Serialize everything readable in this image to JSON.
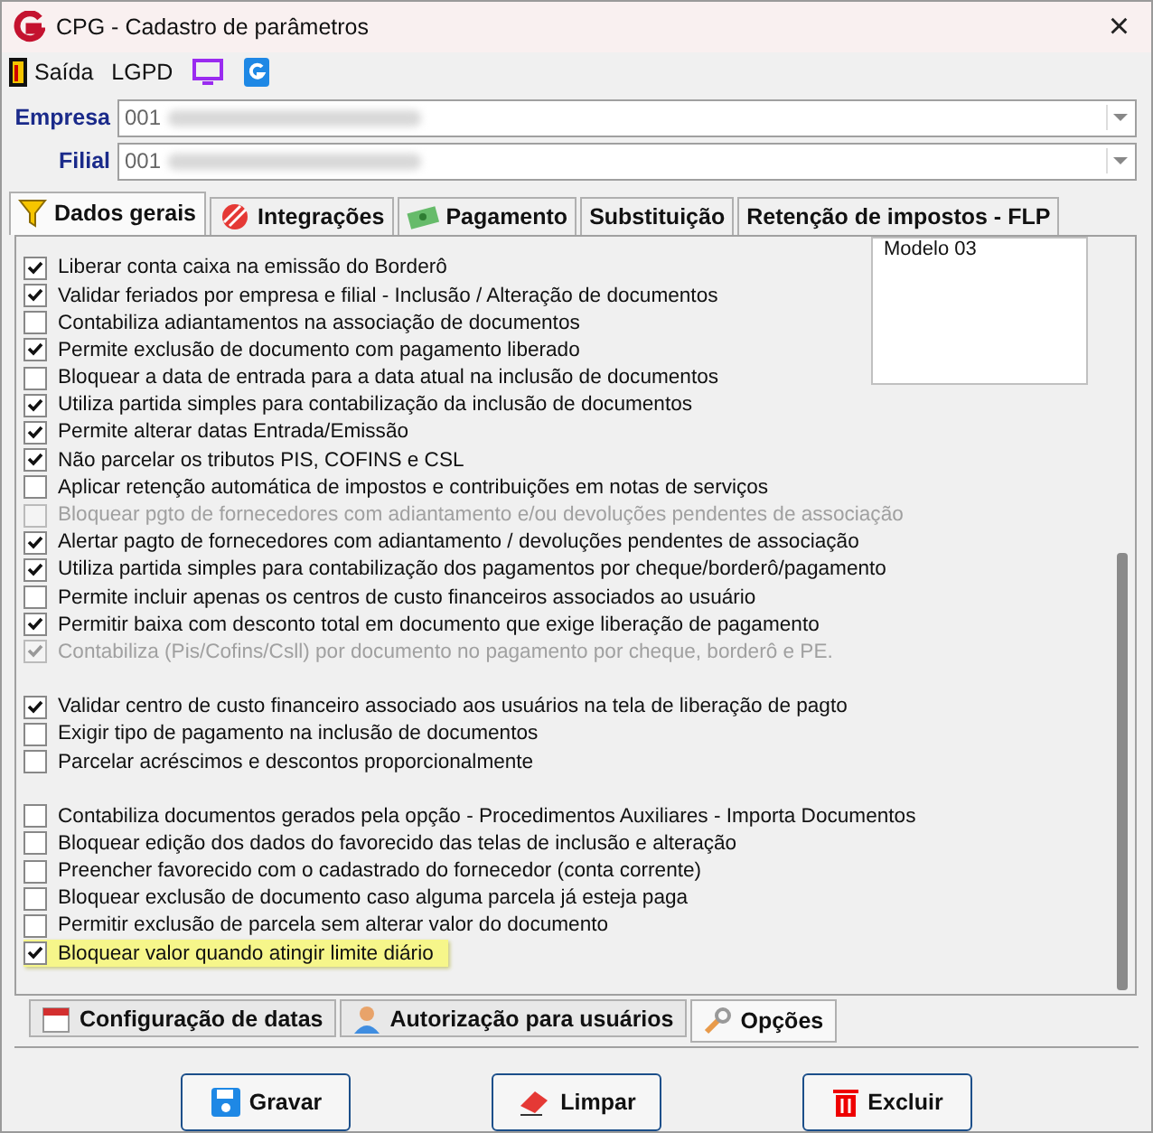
{
  "window": {
    "title": "CPG - Cadastro de parâmetros",
    "close": "×"
  },
  "toolbar": [
    {
      "kind": "exit",
      "label": "Saída"
    },
    {
      "kind": "text",
      "label": "LGPD"
    },
    {
      "kind": "monitor"
    },
    {
      "kind": "logo"
    }
  ],
  "fields": [
    {
      "label": "Empresa",
      "value": "001",
      "redacted": true
    },
    {
      "label": "Filial",
      "value": "001",
      "redacted": true
    }
  ],
  "tabs": [
    {
      "label": "Dados gerais",
      "selected": true
    },
    {
      "label": "Integrações",
      "selected": false
    },
    {
      "label": "Pagamento",
      "selected": false
    },
    {
      "label": "Substituição",
      "selected": false
    },
    {
      "label": "Retenção de impostos - FLP",
      "selected": false
    }
  ],
  "side_list": [
    "Modelo 03"
  ],
  "option_groups": [
    {
      "options": [
        {
          "label": "Liberar conta caixa na emissão do Borderô",
          "checked": true,
          "disabled": false
        },
        {
          "label": "Validar feriados por empresa e filial - Inclusão / Alteração de documentos",
          "checked": true,
          "disabled": false
        },
        {
          "label": "Contabiliza adiantamentos na associação de documentos",
          "checked": false,
          "disabled": false
        },
        {
          "label": "Permite exclusão de documento com pagamento liberado",
          "checked": true,
          "disabled": false
        },
        {
          "label": "Bloquear a data de entrada para a data atual na inclusão de documentos",
          "checked": false,
          "disabled": false
        },
        {
          "label": "Utiliza partida simples para contabilização da inclusão de documentos",
          "checked": true,
          "disabled": false
        },
        {
          "label": "Permite alterar datas Entrada/Emissão",
          "checked": true,
          "disabled": false
        },
        {
          "label": "Não parcelar os tributos PIS, COFINS e CSL",
          "checked": true,
          "disabled": false
        },
        {
          "label": "Aplicar retenção automática de impostos e contribuições em notas de serviços",
          "checked": false,
          "disabled": false
        },
        {
          "label": "Bloquear pgto de fornecedores com adiantamento e/ou devoluções pendentes de associação",
          "checked": false,
          "disabled": true
        },
        {
          "label": "Alertar pagto de fornecedores com adiantamento / devoluções pendentes de associação",
          "checked": true,
          "disabled": false
        },
        {
          "label": "Utiliza partida simples para contabilização dos pagamentos por cheque/borderô/pagamento",
          "checked": true,
          "disabled": false
        },
        {
          "label": "Permite incluir apenas os centros de custo financeiros associados ao usuário",
          "checked": false,
          "disabled": false
        },
        {
          "label": "Permitir baixa com desconto total em documento que exige liberação de pagamento",
          "checked": true,
          "disabled": false
        },
        {
          "label": "Contabiliza (Pis/Cofins/Csll) por documento no pagamento por cheque, borderô e PE.",
          "checked": true,
          "disabled": true
        }
      ]
    },
    {
      "options": [
        {
          "label": "Validar centro de custo financeiro associado aos usuários na tela de liberação de pagto",
          "checked": true,
          "disabled": false
        },
        {
          "label": "Exigir tipo de pagamento na inclusão de documentos",
          "checked": false,
          "disabled": false
        },
        {
          "label": "Parcelar acréscimos e descontos proporcionalmente",
          "checked": false,
          "disabled": false
        }
      ]
    },
    {
      "options": [
        {
          "label": "Contabiliza documentos gerados pela opção - Procedimentos Auxiliares - Importa Documentos",
          "checked": false,
          "disabled": false
        },
        {
          "label": "Bloquear edição dos dados do  favorecido das telas de inclusão e alteração",
          "checked": false,
          "disabled": false
        },
        {
          "label": "Preencher favorecido com o cadastrado do fornecedor (conta corrente)",
          "checked": false,
          "disabled": false
        },
        {
          "label": "Bloquear exclusão de documento caso alguma parcela já esteja paga",
          "checked": false,
          "disabled": false
        },
        {
          "label": "Permitir exclusão de parcela sem alterar valor do documento",
          "checked": false,
          "disabled": false
        },
        {
          "label": "Bloquear valor quando atingir limite diário",
          "checked": true,
          "disabled": false,
          "highlighted": true
        }
      ]
    }
  ],
  "bottom_tabs": [
    {
      "label": "Configuração de datas",
      "selected": false
    },
    {
      "label": "Autorização para usuários",
      "selected": false
    },
    {
      "label": "Opções",
      "selected": true
    }
  ],
  "buttons": [
    "Gravar",
    "Limpar",
    "Excluir"
  ]
}
